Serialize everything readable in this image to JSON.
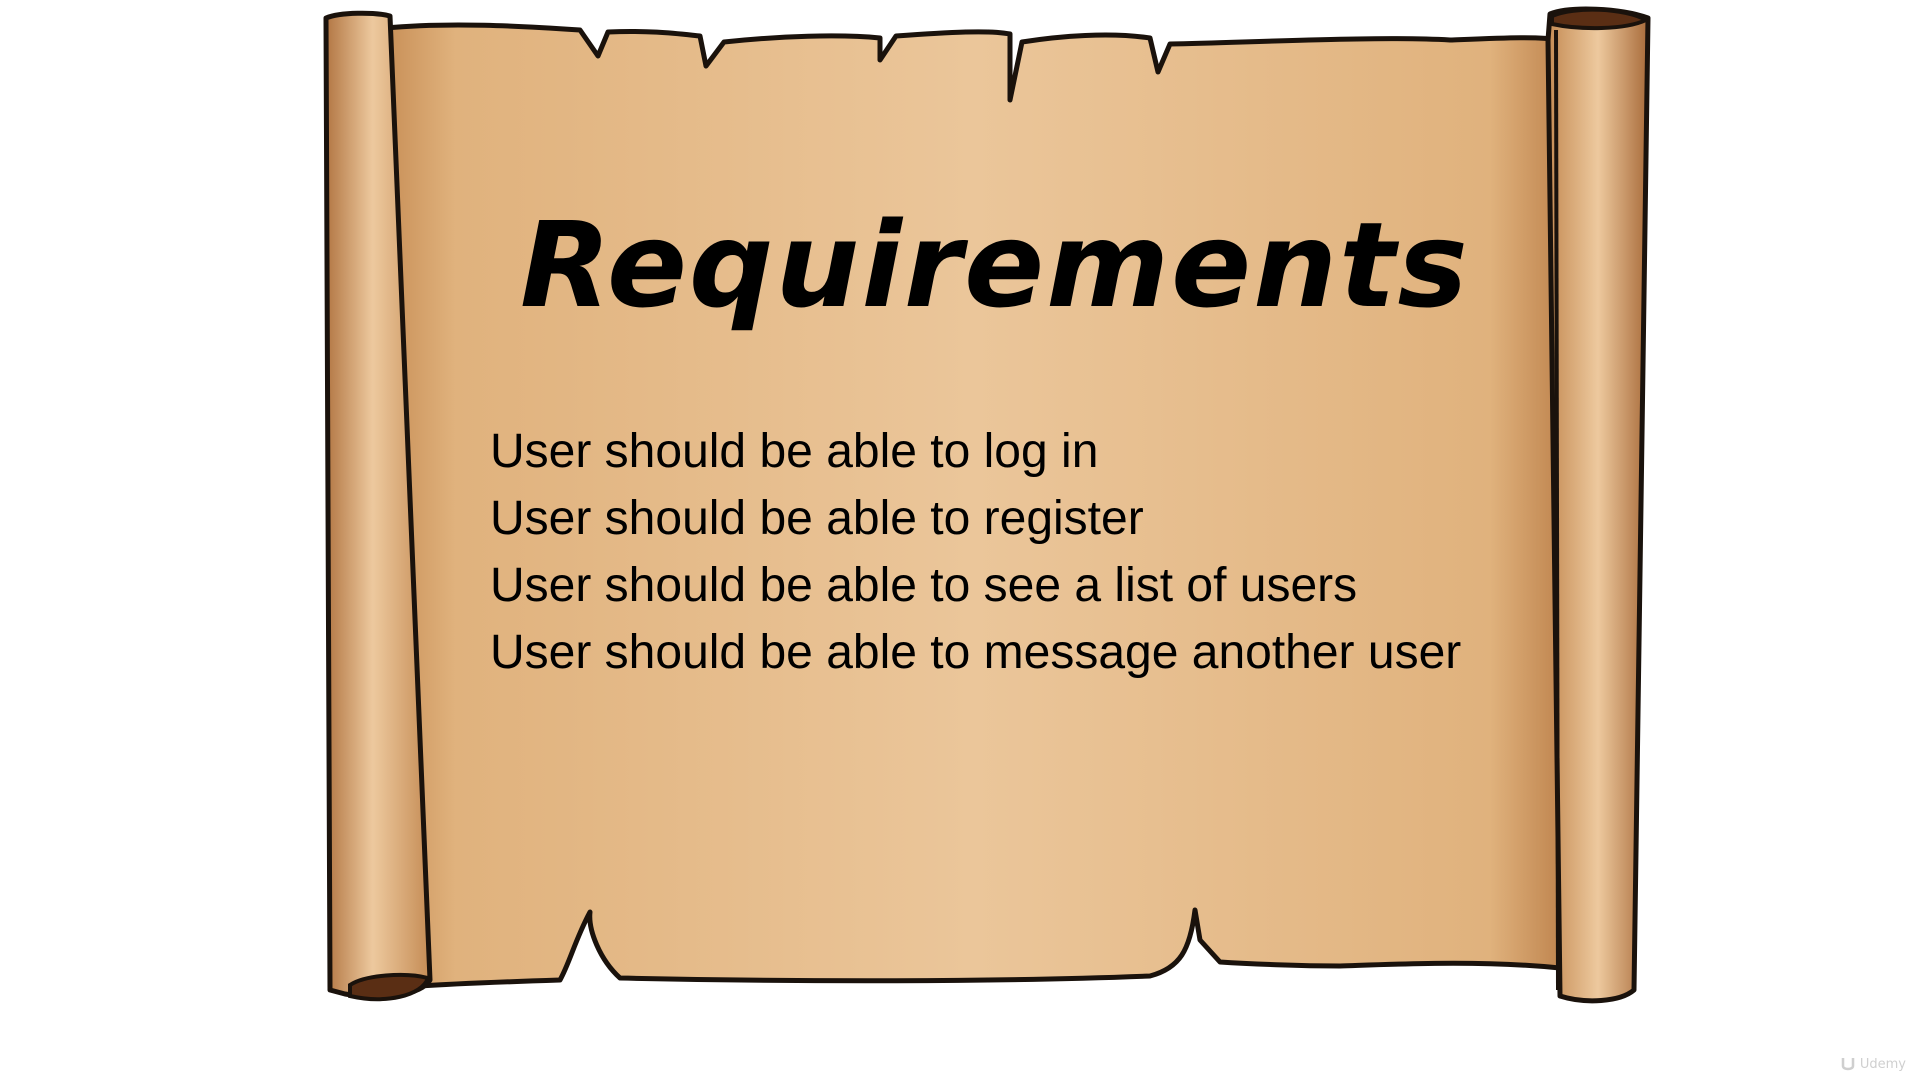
{
  "slide": {
    "title": "Requirements",
    "requirements": [
      "User should be able to log in",
      "User should be able to register",
      "User should be able to see a list of users",
      "User should be able to message another user"
    ]
  },
  "watermark": {
    "text": "Udemy",
    "icon": "udemy-logo-icon"
  },
  "colors": {
    "parchment_light": "#EBC79A",
    "parchment": "#E3B887",
    "parchment_dark": "#B9804A",
    "roll_shadow": "#5A2E14",
    "outline": "#1A120C",
    "text": "#000000",
    "background": "#FFFFFF"
  }
}
